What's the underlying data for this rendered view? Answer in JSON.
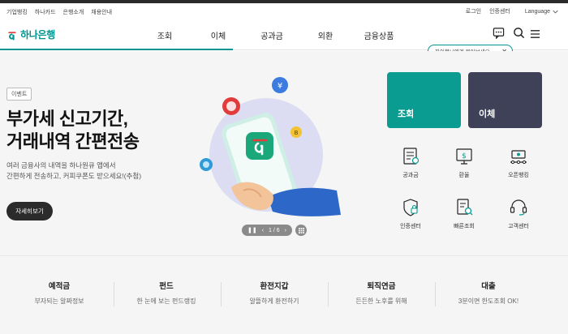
{
  "utility": {
    "links": [
      "기업뱅킹",
      "하나카드",
      "은행소개",
      "채용안내"
    ],
    "login": "로그인",
    "cert_center": "인증센터",
    "language": "Language"
  },
  "header": {
    "logo_text": "하나은행",
    "nav": [
      "조회",
      "이체",
      "공과금",
      "외환",
      "금융상품"
    ]
  },
  "tooltip": {
    "text": "하이봇님에게 물어보세요~"
  },
  "hero": {
    "badge": "이벤트",
    "title_line1": "부가세 신고기간,",
    "title_line2": "거래내역 간편전송",
    "desc_line1": "여러 금융사의 내역을 하나원큐 앱에서",
    "desc_line2": "간편하게 전송하고, 커피쿠폰도 받으세요!(추첨)",
    "detail_button": "자세히보기",
    "pager": "1 / 6"
  },
  "cards": [
    {
      "label": "조회",
      "color": "#0a9c91"
    },
    {
      "label": "이체",
      "color": "#3e4157"
    }
  ],
  "quick_menu": [
    {
      "label": "공과금",
      "icon": "bill-icon"
    },
    {
      "label": "환율",
      "icon": "exchange-rate-icon"
    },
    {
      "label": "오픈뱅킹",
      "icon": "open-banking-icon"
    },
    {
      "label": "인증센터",
      "icon": "shield-icon"
    },
    {
      "label": "빠른조회",
      "icon": "quick-search-icon"
    },
    {
      "label": "고객센터",
      "icon": "headset-icon"
    }
  ],
  "products": [
    {
      "title": "예적금",
      "desc": "부자되는 알짜정보"
    },
    {
      "title": "펀드",
      "desc": "한 눈에 보는 펀드랭킹"
    },
    {
      "title": "환전지갑",
      "desc": "알뜰하게 환전하기"
    },
    {
      "title": "퇴직연금",
      "desc": "든든한 노후를 위해"
    },
    {
      "title": "대출",
      "desc": "3분이면 한도조회 OK!"
    }
  ],
  "colors": {
    "brand": "#009490",
    "card_query": "#0a9c91",
    "card_transfer": "#3e4157"
  }
}
